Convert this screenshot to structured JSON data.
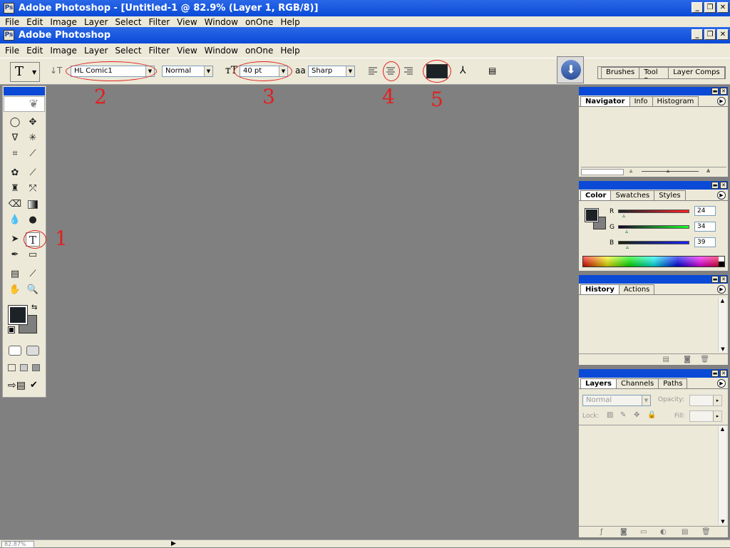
{
  "outer_window": {
    "title": "Adobe Photoshop - [Untitled-1 @ 82.9% (Layer 1, RGB/8)]",
    "menu": [
      "File",
      "Edit",
      "Image",
      "Layer",
      "Select",
      "Filter",
      "View",
      "Window",
      "onOne",
      "Help"
    ]
  },
  "app_window": {
    "title": "Adobe Photoshop",
    "menu": [
      "File",
      "Edit",
      "Image",
      "Layer",
      "Select",
      "Filter",
      "View",
      "Window",
      "onOne",
      "Help"
    ]
  },
  "options": {
    "font_family": "HL Comic1",
    "font_style": "Normal",
    "font_size": "40 pt",
    "aa_label": "aa",
    "antialias": "Sharp",
    "color_swatch": "#1d2227"
  },
  "panel_well": {
    "tabs": [
      "Brushes",
      "Tool Pre",
      "Layer Comps"
    ]
  },
  "annotations": [
    "1",
    "2",
    "3",
    "4",
    "5"
  ],
  "navigator": {
    "tabs": [
      "Navigator",
      "Info",
      "Histogram"
    ]
  },
  "color_panel": {
    "tabs": [
      "Color",
      "Swatches",
      "Styles"
    ],
    "r_label": "R",
    "g_label": "G",
    "b_label": "B",
    "r_value": "24",
    "g_value": "34",
    "b_value": "39",
    "foreground": "#1d2227",
    "background": "#7f7f7f"
  },
  "history": {
    "tabs": [
      "History",
      "Actions"
    ]
  },
  "layers": {
    "tabs": [
      "Layers",
      "Channels",
      "Paths"
    ],
    "blend_mode": "Normal",
    "opacity_label": "Opacity:",
    "lock_label": "Lock:",
    "fill_label": "Fill:"
  },
  "status": {
    "zoom": "82.87%"
  },
  "colors": {
    "titlebar": "#0a4ad6",
    "chrome": "#ece9d8",
    "workspace": "#808080",
    "annotation": "#e02020"
  }
}
